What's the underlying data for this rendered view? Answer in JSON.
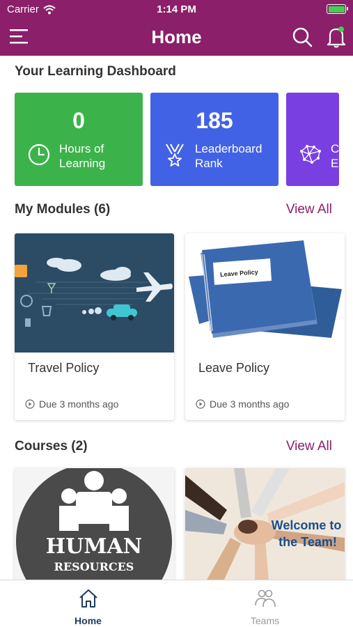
{
  "status_bar": {
    "carrier": "Carrier",
    "time": "1:14 PM"
  },
  "header": {
    "title": "Home",
    "menu_icon": "hamburger-menu-icon",
    "search_icon": "search-icon",
    "bell_icon": "notification-bell-icon"
  },
  "dashboard": {
    "title": "Your Learning Dashboard",
    "cards": [
      {
        "value": "0",
        "label_line1": "Hours of",
        "label_line2": "Learning",
        "icon": "clock-icon",
        "color": "#3cb34a"
      },
      {
        "value": "185",
        "label_line1": "Leaderboard",
        "label_line2": "Rank",
        "icon": "medal-icon",
        "color": "#4262e6"
      },
      {
        "value": "",
        "label_line1": "C",
        "label_line2": "E",
        "icon": "network-brain-icon",
        "color": "#7a3fe0"
      }
    ]
  },
  "modules": {
    "title": "My Modules (6)",
    "view_all": "View All",
    "items": [
      {
        "title": "Travel Policy",
        "due": "Due 3 months ago"
      },
      {
        "title": "Leave Policy",
        "due": "Due 3 months ago",
        "thumb_text": "Leave Policy"
      }
    ]
  },
  "courses": {
    "title": "Courses (2)",
    "view_all": "View All",
    "items": [
      {
        "thumb_line1": "HUMAN",
        "thumb_line2": "RESOURCES"
      },
      {
        "thumb_line1": "Welcome to",
        "thumb_line2": "the Team!"
      }
    ]
  },
  "tabbar": {
    "tabs": [
      {
        "label": "Home",
        "icon": "home-icon",
        "active": true
      },
      {
        "label": "Teams",
        "icon": "teams-icon",
        "active": false
      }
    ]
  },
  "colors": {
    "brand": "#8b1f6a",
    "active_tab": "#1f3a5f",
    "inactive_tab": "#9a9a9a"
  }
}
